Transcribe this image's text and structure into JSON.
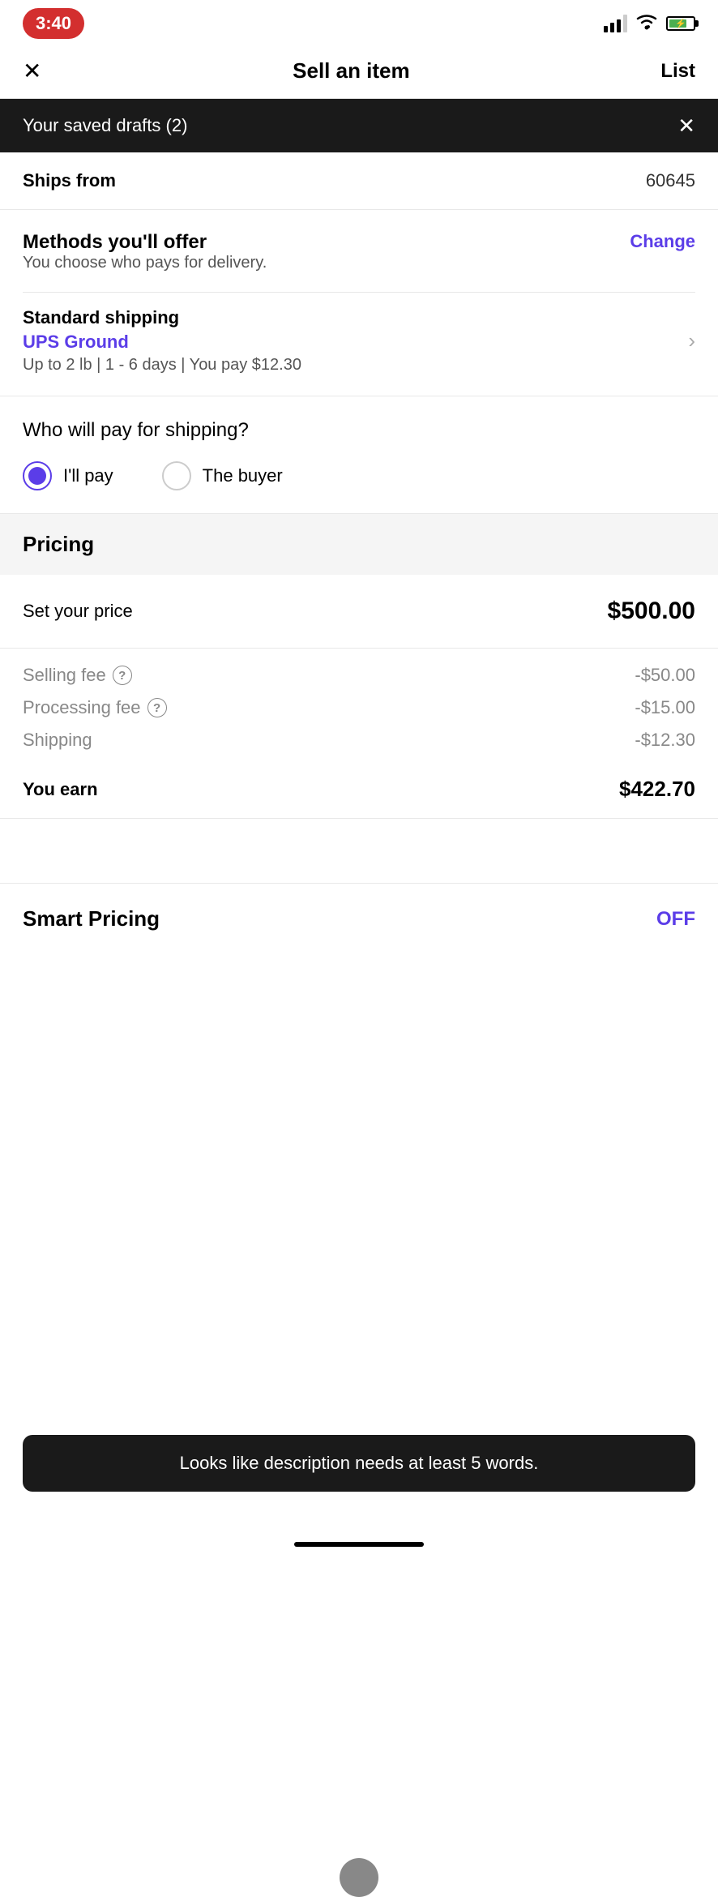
{
  "statusBar": {
    "time": "3:40",
    "battery": "75"
  },
  "header": {
    "title": "Sell an item",
    "listLabel": "List"
  },
  "banner": {
    "text": "Your saved drafts (2)"
  },
  "shipsFrom": {
    "label": "Ships from",
    "value": "60645"
  },
  "methods": {
    "title": "Methods you'll offer",
    "subtitle": "You choose who pays for delivery.",
    "changeLabel": "Change"
  },
  "shipping": {
    "type": "Standard shipping",
    "carrier": "UPS Ground",
    "details": "Up to 2 lb | 1 - 6 days | You pay $12.30"
  },
  "whoPays": {
    "question": "Who will pay for shipping?",
    "option1": "I'll pay",
    "option2": "The buyer"
  },
  "pricing": {
    "sectionTitle": "Pricing",
    "setPriceLabel": "Set your price",
    "setPriceValue": "$500.00",
    "sellingFeeLabel": "Selling fee",
    "sellingFeeValue": "-$50.00",
    "processingFeeLabel": "Processing fee",
    "processingFeeValue": "-$15.00",
    "shippingLabel": "Shipping",
    "shippingValue": "-$12.30",
    "youEarnLabel": "You earn",
    "youEarnValue": "$422.70"
  },
  "smartPricing": {
    "label": "Smart Pricing",
    "value": "OFF"
  },
  "toast": {
    "text": "Looks like description needs at least 5 words."
  }
}
